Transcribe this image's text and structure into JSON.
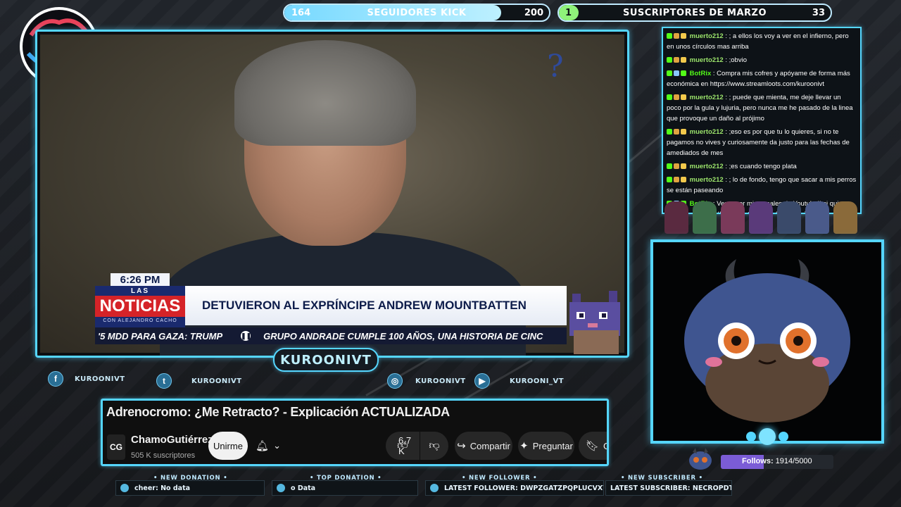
{
  "top_bars": {
    "kick": {
      "current": "164",
      "label": "SEGUIDORES KICK",
      "goal": "200",
      "progress_fraction": 0.82
    },
    "subs": {
      "current": "1",
      "label": "SUSCRIPTORES DE MARZO",
      "goal": "33"
    }
  },
  "broadcast": {
    "time": "6:26 PM",
    "logo_top": "LAS",
    "logo_main": "NOTICIAS",
    "logo_sub": "CON ALEJANDRO CACHO",
    "headline": "DETUVIERON AL EXPRÍNCIPE ANDREW MOUNTBATTEN",
    "ticker_left": "'5 MDD PARA GAZA: TRUMP",
    "ticker_right": "GRUPO ANDRADE CUMPLE 100 AÑOS, UNA HISTORIA DE CINC",
    "deco_glyph": "?"
  },
  "channel_tag": "KUROONIVT",
  "socials": [
    {
      "icon": "facebook-icon",
      "glyph": "f",
      "label": "KUROONIVT"
    },
    {
      "icon": "twitter-icon",
      "glyph": "t",
      "label": "KUROONIVT"
    },
    {
      "icon": "instagram-icon",
      "glyph": "◎",
      "label": "KUROONIVT"
    },
    {
      "icon": "youtube-icon",
      "glyph": "▶",
      "label": "KUROONI_VT"
    }
  ],
  "youtube": {
    "title": "Adrenocromo: ¿Me Retracto? - Explicación ACTUALIZADA",
    "avatar_text": "CG",
    "channel": "ChamoGutiérrez",
    "subscribers": "505 K suscriptores",
    "join": "Unirme",
    "likes": "6,7 K",
    "share": "Compartir",
    "ask": "Preguntar",
    "save": "Gu"
  },
  "chat": [
    {
      "user": "muerto212",
      "bot": false,
      "text": ": ; a ellos los voy a ver en el infierno, pero en unos círculos mas arriba"
    },
    {
      "user": "muerto212",
      "bot": false,
      "text": ": ;obvio"
    },
    {
      "user": "BotRix",
      "bot": true,
      "text": ": Compra mis cofres y apóyame de forma más económica en https://www.streamloots.com/kuroonivt"
    },
    {
      "user": "muerto212",
      "bot": false,
      "text": ": ; puede que mienta, me deje llevar un poco por la gula y lujuria, pero nunca me he pasado de la linea que provoque un daño al prójimo"
    },
    {
      "user": "muerto212",
      "bot": false,
      "text": ": ;eso es por que tu lo quieres, si no te pagamos no vives y curiosamente da justo para las fechas de amediados de mes"
    },
    {
      "user": "muerto212",
      "bot": false,
      "text": ": ;es cuando tengo plata"
    },
    {
      "user": "muerto212",
      "bot": false,
      "text": ": ; lo de fondo, tengo que sacar a mis perros se están paseando"
    },
    {
      "user": "BotRix",
      "bot": true,
      "text": ": Ven a ver mis canales de Youtube!! si quieres más dive... https://www.youtube.com/@kuroonivt"
    }
  ],
  "follows": {
    "label": "Follows:",
    "value": "1914/5000",
    "fraction": 0.383
  },
  "stats": {
    "new_donation": {
      "head": "• NEW DONATION •",
      "value": "cheer: No data"
    },
    "top_donation": {
      "head": "• TOP DONATION •",
      "value": "o Data"
    },
    "new_follower": {
      "head": "• NEW FOLLOWER •",
      "value": "LATEST FOLLOWER: DWPZGATZPQPLUCVXYKY"
    },
    "new_subscriber": {
      "head": "• NEW SUBSCRIBER •",
      "value": "LATEST SUBSCRIBER: NECROPDT"
    }
  },
  "colors": {
    "frame_accent": "#55d6ff",
    "kick_fill": "#77d9ff",
    "subs_fill": "#8ff27a",
    "follows_fill": "#7b5cd6",
    "news_red": "#d52328",
    "news_blue": "#1a2a6e"
  }
}
